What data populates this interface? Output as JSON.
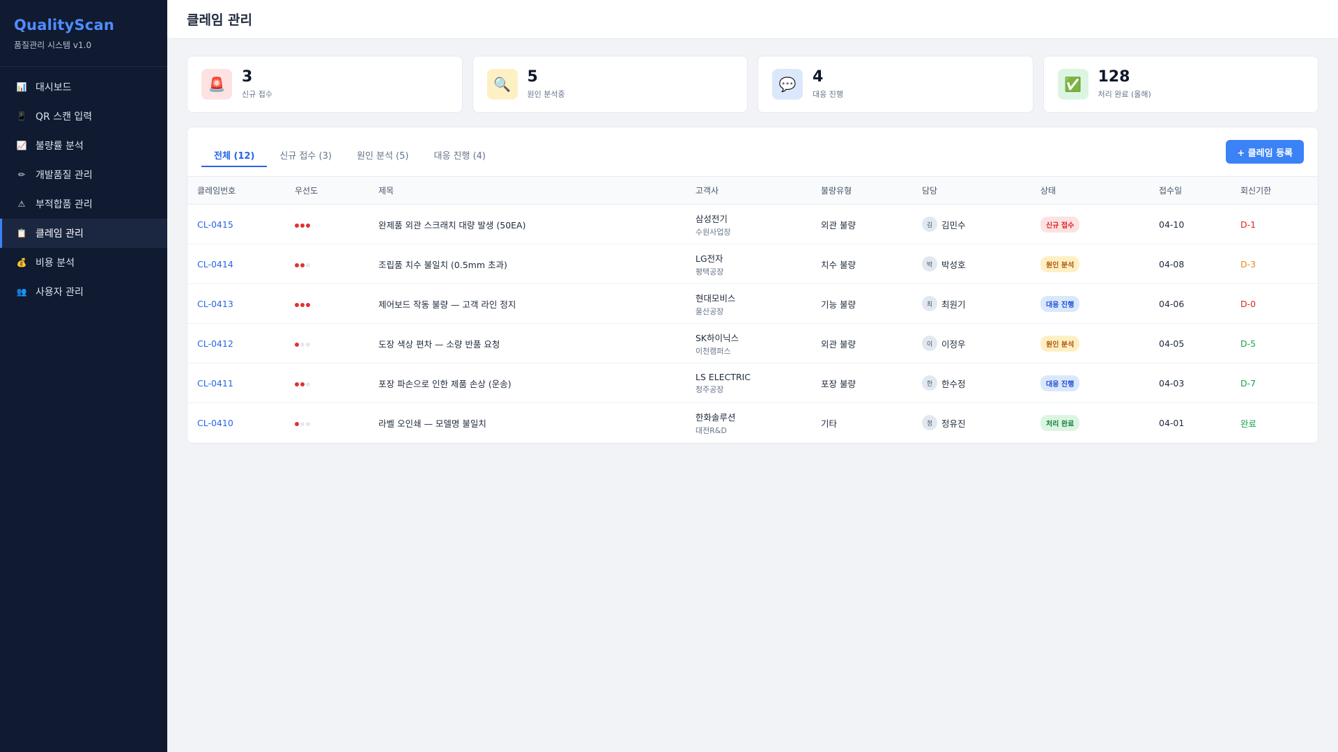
{
  "sidebar": {
    "brand": "QualityScan",
    "subtitle": "품질관리 시스템 v1.0",
    "items": [
      {
        "label": "대시보드",
        "icon": "bar-chart-icon",
        "glyph": "📊",
        "active": false
      },
      {
        "label": "QR 스캔 입력",
        "icon": "phone-icon",
        "glyph": "📱",
        "active": false
      },
      {
        "label": "불량률 분석",
        "icon": "trend-chart-icon",
        "glyph": "📈",
        "active": false
      },
      {
        "label": "개발품질 관리",
        "icon": "pencil-icon",
        "glyph": "✏",
        "active": false
      },
      {
        "label": "부적합품 관리",
        "icon": "warning-icon",
        "glyph": "⚠",
        "active": false
      },
      {
        "label": "클레임 관리",
        "icon": "clipboard-icon",
        "glyph": "📋",
        "active": true
      },
      {
        "label": "비용 분석",
        "icon": "money-bag-icon",
        "glyph": "💰",
        "active": false
      },
      {
        "label": "사용자 관리",
        "icon": "users-icon",
        "glyph": "👥",
        "active": false
      }
    ]
  },
  "header": {
    "title": "클레임 관리"
  },
  "stats": [
    {
      "value": "3",
      "label": "신규 접수",
      "icon": "siren-icon",
      "glyph": "🚨",
      "bg": "#fde2e2"
    },
    {
      "value": "5",
      "label": "원인 분석중",
      "icon": "magnifier-icon",
      "glyph": "🔍",
      "bg": "#fdf0c4"
    },
    {
      "value": "4",
      "label": "대응 진행",
      "icon": "speech-bubble-icon",
      "glyph": "💬",
      "bg": "#dbe8fc"
    },
    {
      "value": "128",
      "label": "처리 완료 (올해)",
      "icon": "check-box-icon",
      "glyph": "✅",
      "bg": "#dcf5e3"
    }
  ],
  "tabs": [
    {
      "label": "전체 (12)",
      "active": true
    },
    {
      "label": "신규 접수 (3)",
      "active": false
    },
    {
      "label": "원인 분석 (5)",
      "active": false
    },
    {
      "label": "대응 진행 (4)",
      "active": false
    }
  ],
  "add_button": "+ 클레임 등록",
  "columns": [
    "클레임번호",
    "우선도",
    "제목",
    "고객사",
    "불량유형",
    "담당",
    "상태",
    "접수일",
    "회신기한"
  ],
  "rows": [
    {
      "id": "CL-0415",
      "priority": 3,
      "title": "완제품 외관 스크래치 대량 발생 (50EA)",
      "customer": "삼성전기",
      "site": "수원사업장",
      "type": "외관 불량",
      "owner_initial": "김",
      "owner": "김민수",
      "status": "신규 접수",
      "status_bg": "#fde2e2",
      "status_color": "#dc2626",
      "date": "04-10",
      "due": "D-1",
      "due_color": "#dc2626"
    },
    {
      "id": "CL-0414",
      "priority": 2,
      "title": "조립품 치수 불일치 (0.5mm 초과)",
      "customer": "LG전자",
      "site": "평택공장",
      "type": "치수 불량",
      "owner_initial": "박",
      "owner": "박성호",
      "status": "원인 분석",
      "status_bg": "#fdf0c4",
      "status_color": "#b45309",
      "date": "04-08",
      "due": "D-3",
      "due_color": "#ea8a0c"
    },
    {
      "id": "CL-0413",
      "priority": 3,
      "title": "제어보드 작동 불량 — 고객 라인 정지",
      "customer": "현대모비스",
      "site": "울산공장",
      "type": "기능 불량",
      "owner_initial": "최",
      "owner": "최원기",
      "status": "대응 진행",
      "status_bg": "#dbe8fc",
      "status_color": "#1d4ed8",
      "date": "04-06",
      "due": "D-0",
      "due_color": "#dc2626"
    },
    {
      "id": "CL-0412",
      "priority": 1,
      "title": "도장 색상 편차 — 소량 반품 요청",
      "customer": "SK하이닉스",
      "site": "이천캠퍼스",
      "type": "외관 불량",
      "owner_initial": "이",
      "owner": "이정우",
      "status": "원인 분석",
      "status_bg": "#fdf0c4",
      "status_color": "#b45309",
      "date": "04-05",
      "due": "D-5",
      "due_color": "#16a34a"
    },
    {
      "id": "CL-0411",
      "priority": 2,
      "title": "포장 파손으로 인한 제품 손상 (운송)",
      "customer": "LS ELECTRIC",
      "site": "청주공장",
      "type": "포장 불량",
      "owner_initial": "한",
      "owner": "한수정",
      "status": "대응 진행",
      "status_bg": "#dbe8fc",
      "status_color": "#1d4ed8",
      "date": "04-03",
      "due": "D-7",
      "due_color": "#16a34a"
    },
    {
      "id": "CL-0410",
      "priority": 1,
      "title": "라벨 오인쇄 — 모델명 불일치",
      "customer": "한화솔루션",
      "site": "대전R&D",
      "type": "기타",
      "owner_initial": "정",
      "owner": "정유진",
      "status": "처리 완료",
      "status_bg": "#dcf5e3",
      "status_color": "#15803d",
      "date": "04-01",
      "due": "완료",
      "due_color": "#16a34a"
    }
  ],
  "colors": {
    "accent": "#3b82f6",
    "priority_on": "#e03131",
    "priority_off": "#e6e8ec"
  }
}
